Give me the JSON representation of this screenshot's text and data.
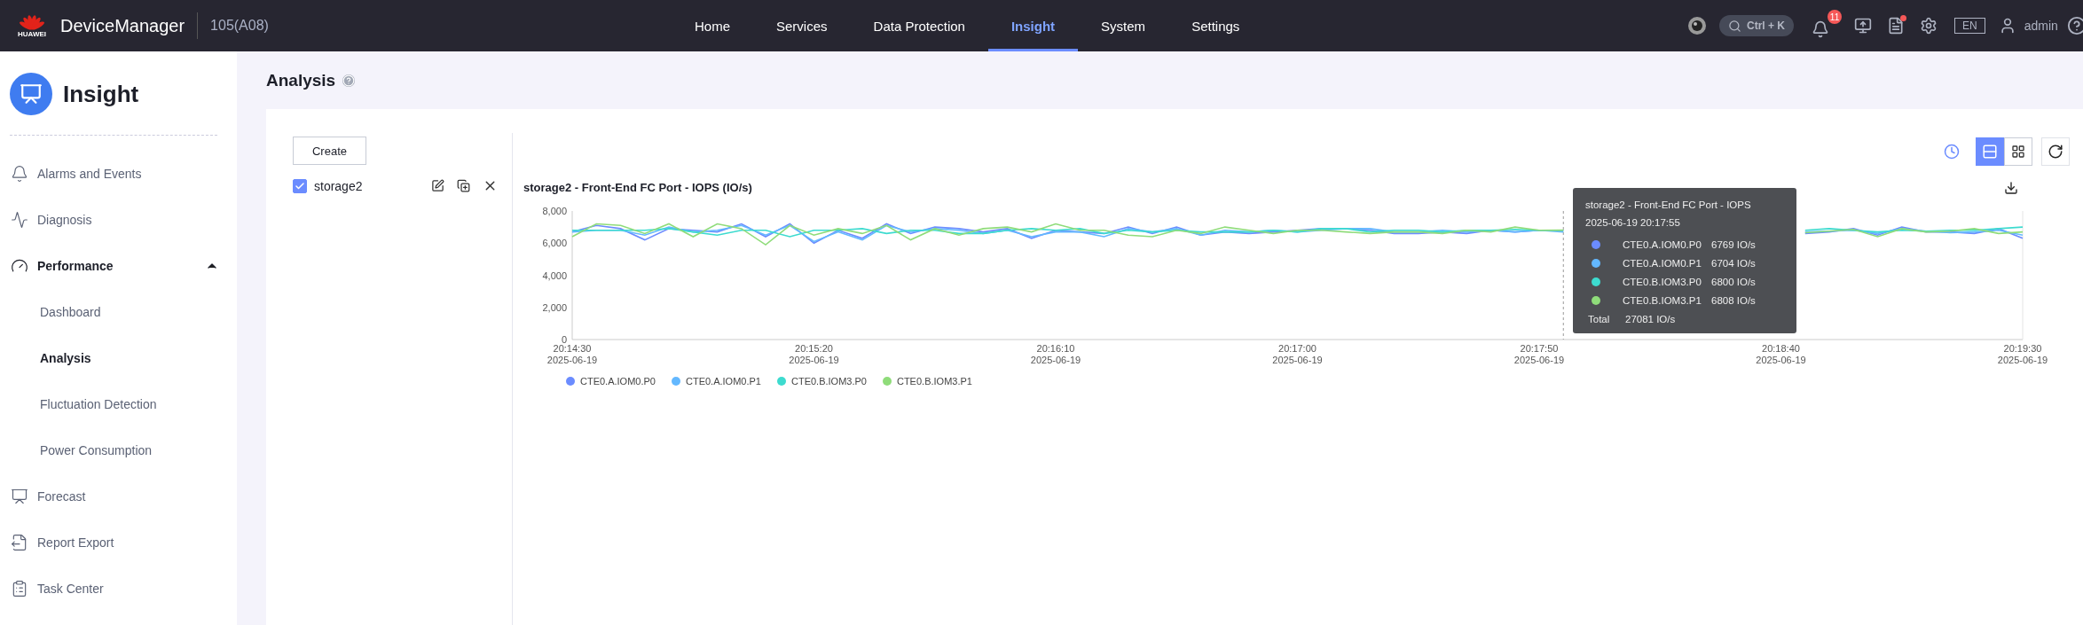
{
  "topbar": {
    "brand": "HUAWEI",
    "product": "DeviceManager",
    "device": "105(A08)",
    "nav": [
      {
        "label": "Home",
        "selected": false
      },
      {
        "label": "Services",
        "selected": false
      },
      {
        "label": "Data Protection",
        "selected": false
      },
      {
        "label": "Insight",
        "selected": true
      },
      {
        "label": "System",
        "selected": false
      },
      {
        "label": "Settings",
        "selected": false
      }
    ],
    "search_shortcut": "Ctrl + K",
    "alarm_count": "11",
    "tasks_unread": true,
    "language": "EN",
    "user": "admin"
  },
  "sidebar": {
    "title": "Insight",
    "items": [
      {
        "label": "Alarms and Events",
        "selected": false
      },
      {
        "label": "Diagnosis",
        "selected": false
      },
      {
        "label": "Performance",
        "expanded": true,
        "children": [
          {
            "label": "Dashboard",
            "selected": false
          },
          {
            "label": "Analysis",
            "selected": true
          },
          {
            "label": "Fluctuation Detection",
            "selected": false
          },
          {
            "label": "Power Consumption",
            "selected": false
          }
        ]
      },
      {
        "label": "Forecast",
        "selected": false
      },
      {
        "label": "Report Export",
        "selected": false
      },
      {
        "label": "Task Center",
        "selected": false
      }
    ]
  },
  "page": {
    "title": "Analysis"
  },
  "analyses": {
    "create_button": "Create",
    "items": [
      {
        "label": "storage2",
        "checked": true
      }
    ]
  },
  "view_modes": [
    {
      "selected": true
    },
    {
      "selected": false
    }
  ],
  "chart": {
    "chart_data": {
      "type": "line",
      "title": "storage2 - Front-End FC Port - IOPS (IO/s)",
      "ylim": [
        0,
        8000
      ],
      "categories": [
        "20:14:30\n2025-06-19",
        null,
        null,
        null,
        null,
        null,
        null,
        null,
        null,
        null,
        "20:15:20\n2025-06-19",
        null,
        null,
        null,
        null,
        null,
        null,
        null,
        null,
        null,
        "20:16:10\n2025-06-19",
        null,
        null,
        null,
        null,
        null,
        null,
        null,
        null,
        null,
        "20:17:00\n2025-06-19",
        null,
        null,
        null,
        null,
        null,
        null,
        null,
        null,
        null,
        "20:17:50\n2025-06-19",
        null,
        null,
        null,
        null,
        null,
        null,
        null,
        null,
        null,
        "20:18:40\n2025-06-19",
        null,
        null,
        null,
        null,
        null,
        null,
        null,
        null,
        null,
        "20:19:30\n2025-06-19"
      ],
      "yticks": [
        {
          "value": 0,
          "label": "0"
        },
        {
          "value": 2000,
          "label": "2,000"
        },
        {
          "value": 4000,
          "label": "4,000"
        },
        {
          "value": 6000,
          "label": "6,000"
        },
        {
          "value": 8000,
          "label": "8,000"
        }
      ],
      "series": [
        {
          "name": "CTE0.A.IOM0.P0",
          "color": "#6b8cff",
          "values": [
            6700,
            7100,
            6900,
            6200,
            6900,
            6800,
            6700,
            7200,
            6400,
            7200,
            6000,
            6800,
            6300,
            7200,
            6600,
            7000,
            6900,
            6700,
            6900,
            6300,
            6800,
            6700,
            6600,
            7000,
            6600,
            7000,
            6500,
            6700,
            6600,
            6700,
            6800,
            6900,
            6900,
            6800,
            6600,
            6600,
            6700,
            6600,
            6800,
            6700,
            6800,
            6770,
            null,
            null,
            null,
            null,
            null,
            null,
            null,
            null,
            null,
            6600,
            6700,
            6900,
            6500,
            7000,
            6700,
            6700,
            6600,
            6900,
            6300
          ]
        },
        {
          "name": "CTE0.A.IOM0.P1",
          "color": "#63b8ff",
          "values": [
            6700,
            6800,
            6800,
            6500,
            7000,
            6700,
            6800,
            7100,
            6500,
            7100,
            6100,
            6700,
            6200,
            7100,
            6700,
            6900,
            6800,
            6600,
            6800,
            6400,
            6700,
            6700,
            6400,
            6900,
            6700,
            6900,
            6500,
            6800,
            6700,
            6800,
            6700,
            6800,
            6900,
            6900,
            6700,
            6700,
            6800,
            6700,
            6800,
            6700,
            6800,
            6700,
            null,
            null,
            null,
            null,
            null,
            null,
            null,
            null,
            null,
            6700,
            6750,
            6800,
            6600,
            6900,
            6750,
            6650,
            6700,
            6800,
            6500
          ]
        },
        {
          "name": "CTE0.B.IOM3.P0",
          "color": "#3ddbcf",
          "values": [
            6800,
            6800,
            6800,
            6800,
            6900,
            6700,
            6500,
            6800,
            6800,
            6400,
            6800,
            6800,
            6900,
            6600,
            6800,
            6800,
            6600,
            6600,
            6800,
            6900,
            6800,
            6900,
            6600,
            6800,
            6700,
            6800,
            6700,
            6700,
            6700,
            6800,
            6700,
            6900,
            6900,
            6700,
            6800,
            6800,
            6700,
            6800,
            6800,
            6850,
            6800,
            6800,
            null,
            null,
            null,
            null,
            null,
            null,
            null,
            null,
            null,
            6800,
            6900,
            6800,
            6700,
            6800,
            6750,
            6800,
            6800,
            6900,
            7000
          ]
        },
        {
          "name": "CTE0.B.IOM3.P1",
          "color": "#8fdc7a",
          "values": [
            6400,
            7200,
            7100,
            6600,
            7200,
            6400,
            7200,
            6900,
            5900,
            7100,
            6500,
            6900,
            6600,
            7100,
            6200,
            6900,
            6500,
            6900,
            7000,
            6700,
            7200,
            6800,
            6800,
            6500,
            6400,
            6800,
            6600,
            7000,
            6800,
            6600,
            6800,
            6800,
            6700,
            6600,
            6700,
            6700,
            6600,
            6800,
            6700,
            7000,
            6800,
            6810,
            null,
            null,
            null,
            null,
            null,
            null,
            null,
            null,
            null,
            6650,
            6750,
            6850,
            6400,
            6900,
            6700,
            6750,
            6900,
            6600,
            6700
          ]
        }
      ]
    },
    "tooltip": {
      "title": "storage2 - Front-End FC Port - IOPS",
      "time": "2025-06-19 20:17:55",
      "rows": [
        {
          "name": "CTE0.A.IOM0.P0",
          "value": "6769 IO/s",
          "color": "#6b8cff"
        },
        {
          "name": "CTE0.A.IOM0.P1",
          "value": "6704 IO/s",
          "color": "#63b8ff"
        },
        {
          "name": "CTE0.B.IOM3.P0",
          "value": "6800 IO/s",
          "color": "#3ddbcf"
        },
        {
          "name": "CTE0.B.IOM3.P1",
          "value": "6808 IO/s",
          "color": "#8fdc7a"
        }
      ],
      "total_label": "Total",
      "total_value": "27081 IO/s"
    }
  }
}
